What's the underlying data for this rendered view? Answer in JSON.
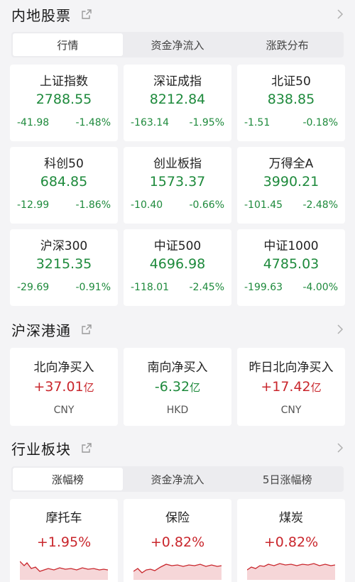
{
  "mainland": {
    "title": "内地股票",
    "tabs": [
      {
        "label": "行情",
        "active": true
      },
      {
        "label": "资金净流入",
        "active": false
      },
      {
        "label": "涨跌分布",
        "active": false
      }
    ],
    "indices": [
      {
        "name": "上证指数",
        "value": "2788.55",
        "change": "-41.98",
        "pct": "-1.48%"
      },
      {
        "name": "深证成指",
        "value": "8212.84",
        "change": "-163.14",
        "pct": "-1.95%"
      },
      {
        "name": "北证50",
        "value": "838.85",
        "change": "-1.51",
        "pct": "-0.18%"
      },
      {
        "name": "科创50",
        "value": "684.85",
        "change": "-12.99",
        "pct": "-1.86%"
      },
      {
        "name": "创业板指",
        "value": "1573.37",
        "change": "-10.40",
        "pct": "-0.66%"
      },
      {
        "name": "万得全A",
        "value": "3990.21",
        "change": "-101.45",
        "pct": "-2.48%"
      },
      {
        "name": "沪深300",
        "value": "3215.35",
        "change": "-29.69",
        "pct": "-0.91%"
      },
      {
        "name": "中证500",
        "value": "4696.98",
        "change": "-118.01",
        "pct": "-2.45%"
      },
      {
        "name": "中证1000",
        "value": "4785.03",
        "change": "-199.63",
        "pct": "-4.00%"
      }
    ]
  },
  "connect": {
    "title": "沪深港通",
    "items": [
      {
        "name": "北向净买入",
        "value": "+37.01",
        "unit": "亿",
        "currency": "CNY",
        "direction": "up"
      },
      {
        "name": "南向净买入",
        "value": "-6.32",
        "unit": "亿",
        "currency": "HKD",
        "direction": "down"
      },
      {
        "name": "昨日北向净买入",
        "value": "+17.42",
        "unit": "亿",
        "currency": "CNY",
        "direction": "up"
      }
    ]
  },
  "sectors": {
    "title": "行业板块",
    "tabs": [
      {
        "label": "涨幅榜",
        "active": true
      },
      {
        "label": "资金净流入",
        "active": false
      },
      {
        "label": "5日涨幅榜",
        "active": false
      }
    ],
    "items": [
      {
        "name": "摩托车",
        "pct": "+1.95%"
      },
      {
        "name": "保险",
        "pct": "+0.82%"
      },
      {
        "name": "煤炭",
        "pct": "+0.82%"
      }
    ]
  },
  "colors": {
    "up": "#c9262c",
    "down": "#1e8a3c",
    "background": "#f4f4f6",
    "card": "#ffffff"
  },
  "icons": {
    "share": "share-external-icon",
    "more": "chevron-right-icon"
  }
}
